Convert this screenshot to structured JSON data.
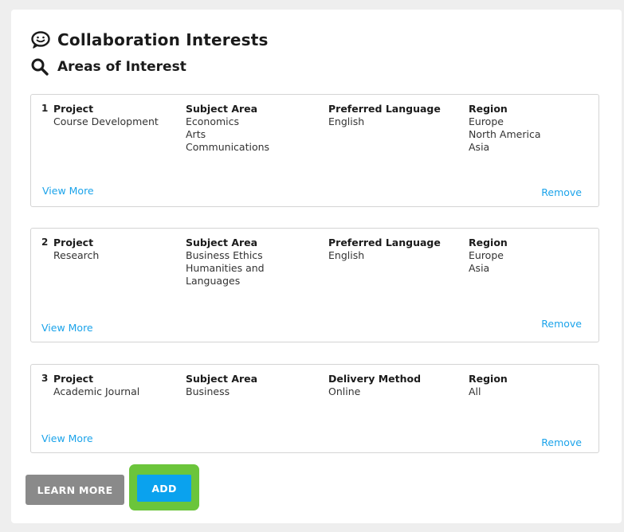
{
  "header": {
    "title": "Collaboration Interests",
    "subtitle": "Areas of Interest",
    "title_icon": "speech-bubble-smile-icon",
    "subtitle_icon": "search-icon"
  },
  "cards": [
    {
      "number": "1",
      "col1_label": "Project",
      "col1_values": [
        "Course Development"
      ],
      "col2_label": "Subject Area",
      "col2_values": [
        "Economics",
        "Arts",
        "Communications"
      ],
      "col3_label": "Preferred Language",
      "col3_values": [
        "English"
      ],
      "col4_label": "Region",
      "col4_values": [
        "Europe",
        "North America",
        "Asia"
      ],
      "view_more": "View More",
      "remove": "Remove"
    },
    {
      "number": "2",
      "col1_label": "Project",
      "col1_values": [
        "Research"
      ],
      "col2_label": "Subject Area",
      "col2_values": [
        "Business Ethics",
        "Humanities and",
        "Languages"
      ],
      "col3_label": "Preferred Language",
      "col3_values": [
        "English"
      ],
      "col4_label": "Region",
      "col4_values": [
        "Europe",
        "Asia"
      ],
      "view_more": "View More",
      "remove": "Remove"
    },
    {
      "number": "3",
      "col1_label": "Project",
      "col1_values": [
        "Academic Journal"
      ],
      "col2_label": "Subject Area",
      "col2_values": [
        "Business"
      ],
      "col3_label": "Delivery Method",
      "col3_values": [
        "Online"
      ],
      "col4_label": "Region",
      "col4_values": [
        "All"
      ],
      "view_more": "View More",
      "remove": "Remove"
    }
  ],
  "actions": {
    "learn_more": "LEARN MORE",
    "add": "ADD"
  },
  "colors": {
    "link": "#1ba3ea",
    "add_button": "#0aa2ee",
    "add_highlight": "#6bc53b",
    "learn_more_button": "#8a8a8a"
  }
}
